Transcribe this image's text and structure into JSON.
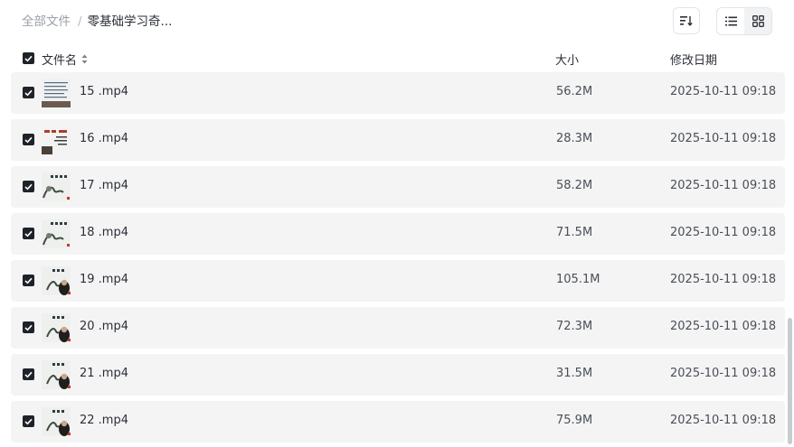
{
  "breadcrumb": {
    "root": "全部文件",
    "separator": "/",
    "current": "零基础学习奇..."
  },
  "toolbar": {
    "sort_icon": "sort-icon",
    "list_view_icon": "list-view-icon",
    "grid_view_icon": "grid-view-icon",
    "active_view": "list"
  },
  "header": {
    "name": "文件名",
    "size": "大小",
    "date": "修改日期"
  },
  "files": [
    {
      "name": "15 .mp4",
      "size": "56.2M",
      "date": "2025-10-11 09:18",
      "thumb": "text-board"
    },
    {
      "name": "16 .mp4",
      "size": "28.3M",
      "date": "2025-10-11 09:18",
      "thumb": "text-board-red"
    },
    {
      "name": "17 .mp4",
      "size": "58.2M",
      "date": "2025-10-11 09:18",
      "thumb": "painting"
    },
    {
      "name": "18 .mp4",
      "size": "71.5M",
      "date": "2025-10-11 09:18",
      "thumb": "painting"
    },
    {
      "name": "19 .mp4",
      "size": "105.1M",
      "date": "2025-10-11 09:18",
      "thumb": "painting-person"
    },
    {
      "name": "20 .mp4",
      "size": "72.3M",
      "date": "2025-10-11 09:18",
      "thumb": "painting-person"
    },
    {
      "name": "21 .mp4",
      "size": "31.5M",
      "date": "2025-10-11 09:18",
      "thumb": "painting-person"
    },
    {
      "name": "22 .mp4",
      "size": "75.9M",
      "date": "2025-10-11 09:18",
      "thumb": "painting-person"
    }
  ],
  "colors": {
    "row_bg": "#f4f4f5",
    "checkbox": "#1f2329",
    "muted_text": "#9aa0a6"
  }
}
